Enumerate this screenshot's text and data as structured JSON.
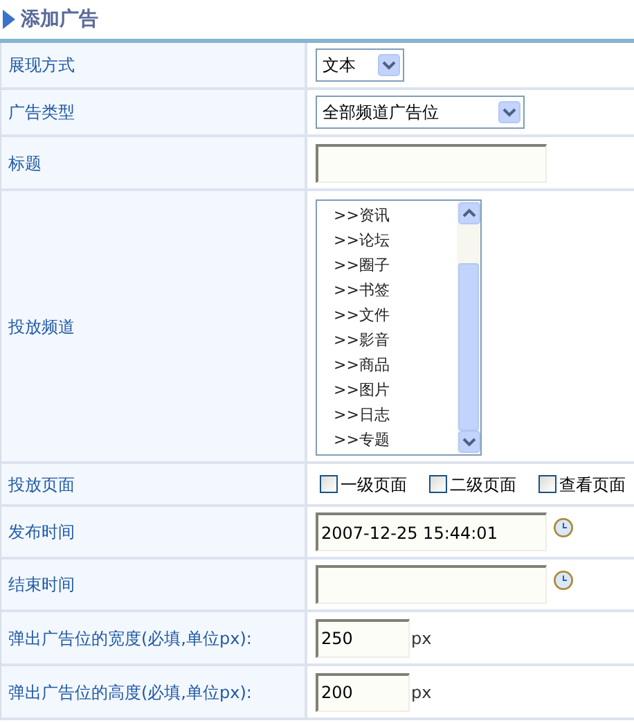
{
  "title": "添加广告",
  "rows": [
    {
      "label": "展现方式",
      "kind": "select",
      "value": "文本"
    },
    {
      "label": "广告类型",
      "kind": "select",
      "value": "全部频道广告位"
    },
    {
      "label": "标题",
      "kind": "text"
    },
    {
      "label": "投放频道",
      "kind": "listbox",
      "options": [
        {
          "label": ">>资讯",
          "selected": false
        },
        {
          "label": ">>论坛",
          "selected": false
        },
        {
          "label": ">>圈子",
          "selected": false
        },
        {
          "label": ">>书签",
          "selected": false
        },
        {
          "label": ">>文件",
          "selected": false
        },
        {
          "label": ">>影音",
          "selected": false
        },
        {
          "label": ">>商品",
          "selected": false
        },
        {
          "label": ">>图片",
          "selected": false
        },
        {
          "label": ">>日志",
          "selected": false
        },
        {
          "label": ">>专题",
          "selected": false
        }
      ]
    },
    {
      "label": "投放页面",
      "kind": "checkboxes",
      "options": [
        {
          "label": "一级页面",
          "checked": false
        },
        {
          "label": "二级页面",
          "checked": false
        },
        {
          "label": "查看页面",
          "checked": false
        }
      ]
    },
    {
      "label": "发布时间",
      "kind": "datetime",
      "value": "2007-12-25 15:44:01"
    },
    {
      "label": "结束时间",
      "kind": "datetime"
    },
    {
      "label": "弹出广告位的宽度(必填,单位px):",
      "kind": "number",
      "value": "250",
      "unit": "px"
    },
    {
      "label": "弹出广告位的高度(必填,单位px):",
      "kind": "number",
      "value": "200",
      "unit": "px"
    }
  ]
}
